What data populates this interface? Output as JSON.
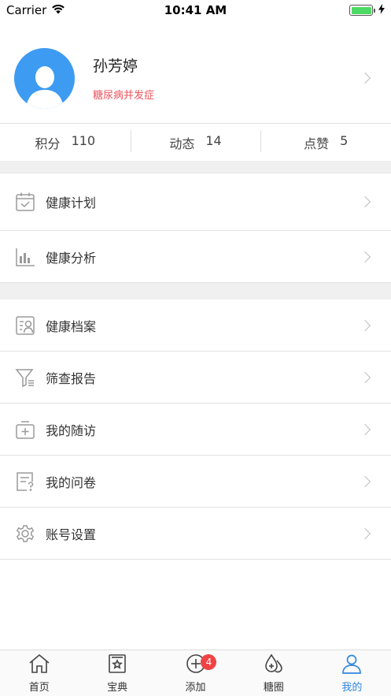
{
  "status_bar": {
    "carrier": "Carrier",
    "time": "10:41 AM",
    "battery_level": 1.0
  },
  "profile": {
    "name": "孙芳婷",
    "tag": "糖尿病并发症"
  },
  "stats": [
    {
      "label": "积分",
      "value": "110"
    },
    {
      "label": "动态",
      "value": "14"
    },
    {
      "label": "点赞",
      "value": "5"
    }
  ],
  "menu_group_1": [
    {
      "label": "健康计划",
      "icon": "calendar-check-icon"
    },
    {
      "label": "健康分析",
      "icon": "bar-chart-icon"
    }
  ],
  "menu_group_2": [
    {
      "label": "健康档案",
      "icon": "profile-record-icon"
    },
    {
      "label": "筛查报告",
      "icon": "filter-report-icon"
    },
    {
      "label": "我的随访",
      "icon": "medical-box-icon"
    },
    {
      "label": "我的问卷",
      "icon": "questionnaire-icon"
    },
    {
      "label": "账号设置",
      "icon": "gear-icon"
    }
  ],
  "tabbar": {
    "tabs": [
      {
        "label": "首页",
        "icon": "home-icon"
      },
      {
        "label": "宝典",
        "icon": "book-star-icon"
      },
      {
        "label": "添加",
        "icon": "add-circle-icon",
        "badge": "4"
      },
      {
        "label": "糖圈",
        "icon": "drops-icon"
      },
      {
        "label": "我的",
        "icon": "user-icon",
        "active": true
      }
    ]
  },
  "colors": {
    "accent": "#2f86e0",
    "avatar_bg": "#3d9bf2",
    "tag": "#e8545c",
    "badge": "#f04343",
    "battery": "#4cd964"
  }
}
